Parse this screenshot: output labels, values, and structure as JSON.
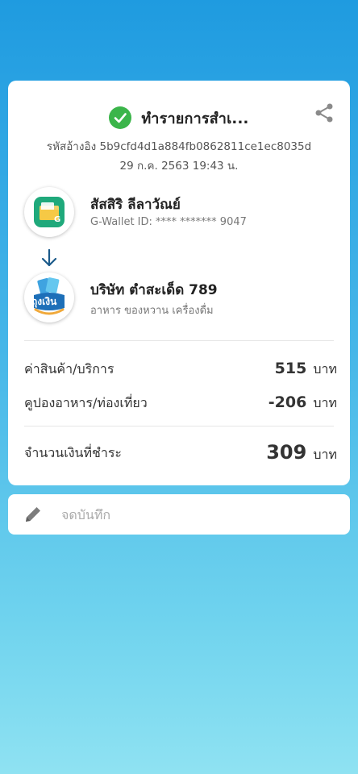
{
  "receipt": {
    "title": "ทำรายการสำเ...",
    "status_color": "#3bb54a",
    "reference": "รหัสอ้างอิง 5b9cfd4d1a884fb0862811ce1ec8035d",
    "datetime": "29 ก.ค. 2563 19:43 น."
  },
  "sender": {
    "name": "สัสสิริ ลีลาวัณย์",
    "wallet_id": "G-Wallet ID: **** ******* 9047",
    "icon": "g-wallet-icon"
  },
  "receiver": {
    "name": "บริษัท ตำสะเด็ด 789",
    "category": "อาหาร ของหวาน เครื่องดื่ม",
    "icon": "thung-ngoen-icon",
    "logo_text": "ถุงเงิน"
  },
  "summary": {
    "items": [
      {
        "label": "ค่าสินค้า/บริการ",
        "amount": "515",
        "unit": "บาท"
      },
      {
        "label": "คูปองอาหาร/ท่องเที่ยว",
        "amount": "-206",
        "unit": "บาท"
      }
    ],
    "total": {
      "label": "จำนวนเงินที่ชำระ",
      "amount": "309",
      "unit": "บาท"
    }
  },
  "note": {
    "placeholder": "จดบันทึก"
  }
}
